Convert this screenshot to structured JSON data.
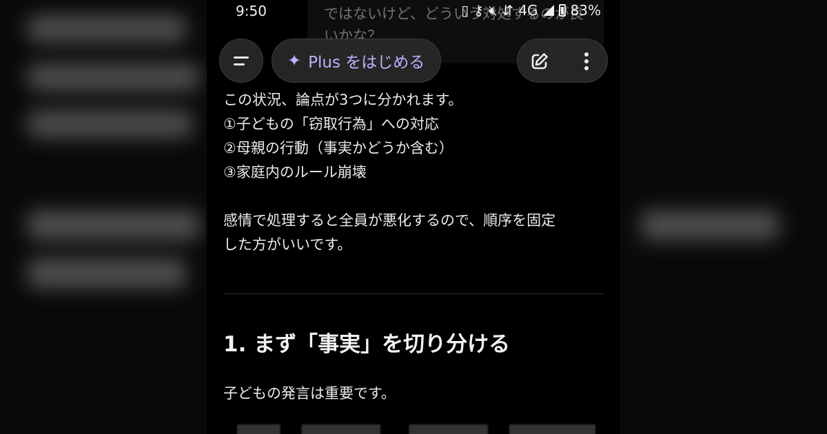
{
  "status_bar": {
    "time": "9:50",
    "network": "4G",
    "battery": "83%"
  },
  "previous_message_fragment": "ではないけど、どういう対処するのが良いかな？",
  "top_bar": {
    "plus_button_label": "Plus をはじめる",
    "icons": [
      "menu-icon",
      "sparkle-icon",
      "new-chat-icon",
      "more-vertical-icon"
    ]
  },
  "reply": {
    "intro": "この状況、論点が3つに分かれます。",
    "points": [
      "①子どもの「窃取行為」への対応",
      "②母親の行動（事実かどうか含む）",
      "③家庭内のルール崩壊"
    ],
    "summary_line1": "感情で処理すると全員が悪化するので、順序を固定",
    "summary_line2": "した方がいいです。",
    "section_heading": "1. まず「事実」を切り分ける",
    "section_para": "子どもの発言は重要です。"
  },
  "colors": {
    "background": "#000000",
    "text": "#ececec",
    "accent": "#b8b4ff",
    "button_bg": "#282828"
  }
}
